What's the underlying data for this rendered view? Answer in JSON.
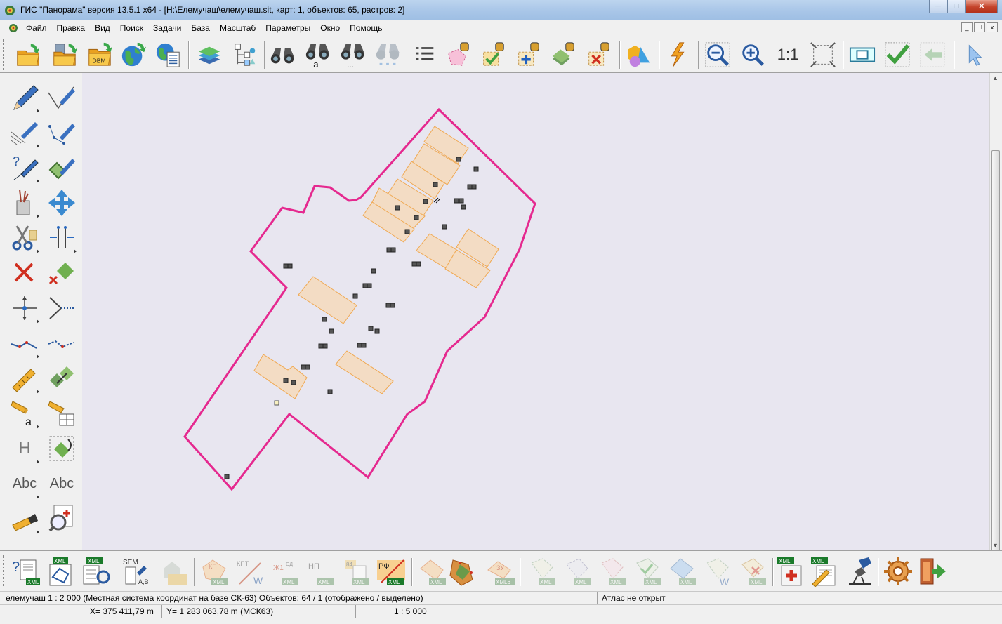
{
  "window": {
    "title": "ГИС \"Панорама\" версия 13.5.1 x64 - [H:\\Елемучаш\\елемучаш.sit, карт: 1, объектов: 65, растров: 2]",
    "minimize": "─",
    "maximize": "□",
    "close": "✕"
  },
  "menu": {
    "items": [
      "Файл",
      "Правка",
      "Вид",
      "Поиск",
      "Задачи",
      "База",
      "Масштаб",
      "Параметры",
      "Окно",
      "Помощь"
    ],
    "mdi_minimize": "_",
    "mdi_restore": "❐",
    "mdi_close": "x"
  },
  "toolbar": {
    "open_label": "",
    "dbm_label": "DBM",
    "search_text_label": "a",
    "search_more_label": "...",
    "scale_label": "1:1",
    "icons": [
      "open-map-icon",
      "open-data-icon",
      "open-dbm-icon",
      "globe-open-icon",
      "globe-list-icon",
      "layers-icon",
      "tree-icon",
      "binoculars-icon",
      "binoculars-text-icon",
      "binoculars-more-icon",
      "binoculars-disabled-icon",
      "list-icon",
      "select-area-icon",
      "select-check-icon",
      "select-add-icon",
      "select-stack-icon",
      "select-remove-icon",
      "objects-3d-icon",
      "lightning-icon",
      "zoom-out-icon",
      "zoom-in-icon",
      "scale-1-1-icon",
      "fit-extent-icon",
      "frame-icon",
      "accept-icon",
      "back-icon",
      "cursor-icon"
    ]
  },
  "lefttools": {
    "text_label_1": "Abc",
    "text_label_2": "Abc",
    "height_label": "H",
    "search_a_label": "a"
  },
  "bottomtools": {
    "xml_label": "XML",
    "sem_label": "SEM",
    "ab_label": "A,B",
    "kp_label": "КП",
    "kpt_label": "КПТ",
    "zh1_label": "Ж1",
    "np_label": "НП",
    "rf_label": "РФ",
    "zu_label": "ЗУ",
    "xml6_label": "XML6",
    "w_label": "W",
    "od_label": "ОД",
    "num_label": "84"
  },
  "status": {
    "map_info": "елемучаш  1 : 2 000 (Местная система координат на базе СК-63) Объектов: 64 / 1 (отображено / выделено)",
    "atlas": "Атлас не открыт",
    "x_coord": "X=   375 411,79 m",
    "y_coord": "Y= 1 283 063,78 m  (МСК63)",
    "scale": "1 : 5 000"
  },
  "colors": {
    "boundary": "#e5298f",
    "building_fill": "#f3dcc4",
    "building_stroke": "#f0a850",
    "map_background": "#e8e6f0"
  }
}
